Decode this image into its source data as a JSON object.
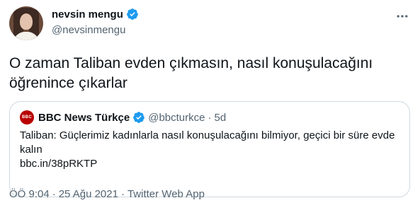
{
  "author": {
    "display_name": "nevsin mengu",
    "handle": "@nevsinmengu",
    "verified": true
  },
  "tweet": {
    "text": "O zaman Taliban evden çıkmasın, nasıl konuşulacağını öğrenince çıkarlar"
  },
  "quoted_tweet": {
    "display_name": "BBC News Türkçe",
    "handle": "@bbcturkce",
    "separator": "·",
    "time": "5d",
    "text": "Taliban: Güçlerimiz kadınlarla nasıl konuşulacağını bilmiyor, geçici bir süre evde kalın",
    "link": "bbc.in/38pRKTP",
    "logo_text": "BBC"
  },
  "footer": {
    "time": "ÖÖ 9:04",
    "separator1": "·",
    "date": "25 Ağu 2021",
    "separator2": "·",
    "source": "Twitter Web App"
  },
  "colors": {
    "verified": "#1d9bf0",
    "secondary_text": "#536471",
    "border": "#cfd9de",
    "bbc_red": "#b80000"
  },
  "icons": {
    "more": "more-dots-icon",
    "verified": "verified-badge-icon"
  }
}
